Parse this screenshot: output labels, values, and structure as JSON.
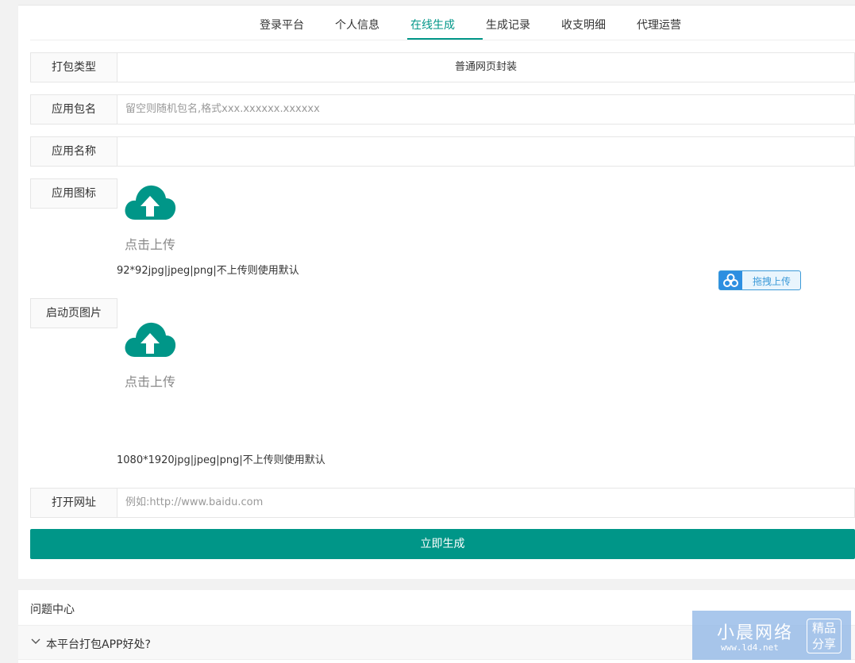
{
  "tabs": {
    "login": "登录平台",
    "profile": "个人信息",
    "generate": "在线生成",
    "history": "生成记录",
    "finance": "收支明细",
    "agent": "代理运营"
  },
  "form": {
    "pack_type_label": "打包类型",
    "pack_type_value": "普通网页封装",
    "package_name_label": "应用包名",
    "package_name_placeholder": "留空则随机包名,格式xxx.xxxxxx.xxxxxx",
    "app_name_label": "应用名称",
    "app_name_value": "",
    "icon_label": "应用图标",
    "icon_upload_text": "点击上传",
    "icon_hint": "92*92jpg|jpeg|png|不上传则使用默认",
    "drag_upload_label": "拖拽上传",
    "splash_label": "启动页图片",
    "splash_upload_text": "点击上传",
    "splash_hint": "1080*1920jpg|jpeg|png|不上传则使用默认",
    "url_label": "打开网址",
    "url_placeholder": "例如:http://www.baidu.com",
    "submit_label": "立即生成"
  },
  "faq": {
    "title": "问题中心",
    "items": [
      {
        "question": "本平台打包APP好处?"
      }
    ]
  },
  "watermark": {
    "title": "小晨网络",
    "url": "www.ld4.net",
    "badge_line1": "精品",
    "badge_line2": "分享"
  },
  "colors": {
    "accent": "#009688",
    "drag_blue": "#2d8fe1"
  }
}
